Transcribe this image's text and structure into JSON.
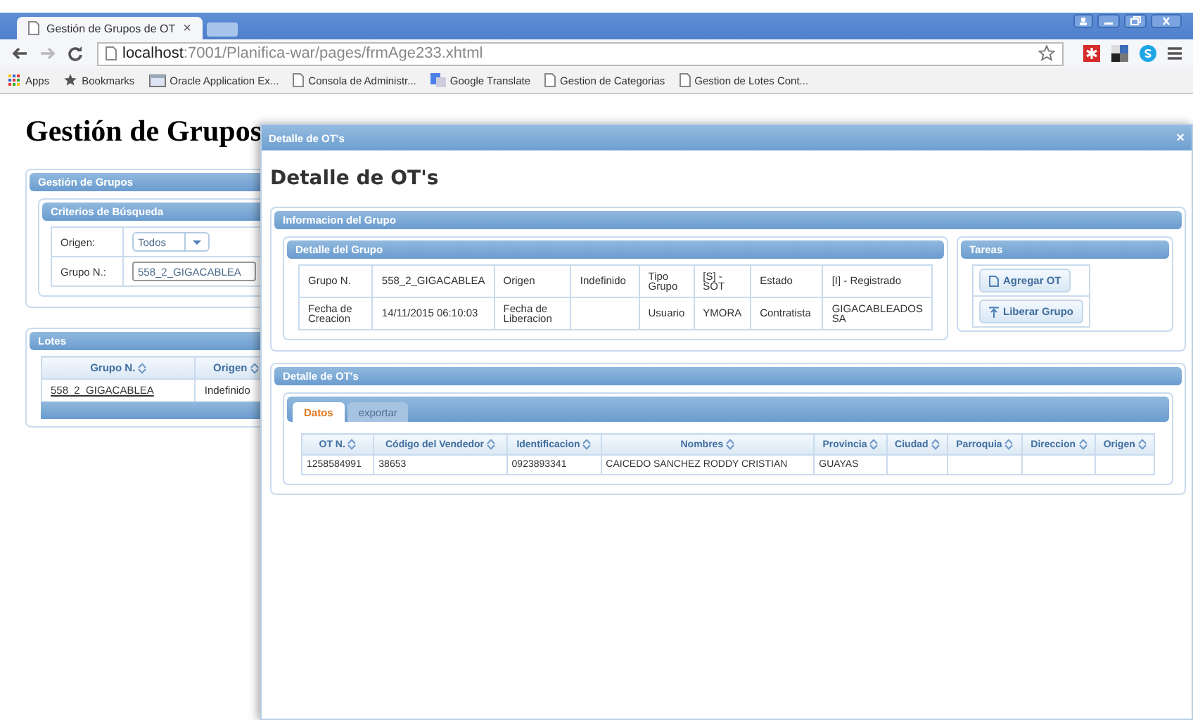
{
  "browser": {
    "tab_title": "Gestión de Grupos de OT",
    "tab_close": "×",
    "url_host": "localhost",
    "url_path": ":7001/Planifica-war/pages/frmAge233.xhtml",
    "bookmarks": [
      {
        "label": "Apps",
        "kind": "apps"
      },
      {
        "label": "Bookmarks",
        "kind": "star"
      },
      {
        "label": "Oracle Application Ex...",
        "kind": "folder"
      },
      {
        "label": "Consola de Administr...",
        "kind": "page"
      },
      {
        "label": "Google Translate",
        "kind": "translate"
      },
      {
        "label": "Gestion de Categorias",
        "kind": "page"
      },
      {
        "label": "Gestion de Lotes Cont...",
        "kind": "page"
      }
    ]
  },
  "page": {
    "heading": "Gestión de Grupos",
    "gestion_panel": {
      "title": "Gestión de Grupos",
      "criteria": {
        "title": "Criterios de Búsqueda",
        "fields": [
          {
            "label": "Origen:",
            "kind": "select",
            "value": "Todos"
          },
          {
            "label": "Grupo N.:",
            "kind": "input",
            "value": "558_2_GIGACABLEA"
          }
        ]
      }
    },
    "lotes": {
      "title": "Lotes",
      "columns": [
        "Grupo N.",
        "Origen"
      ],
      "rows": [
        [
          "558_2_GIGACABLEA",
          "Indefinido"
        ]
      ]
    }
  },
  "dialog": {
    "title": "Detalle de OT's",
    "close": "×",
    "heading": "Detalle de OT's",
    "info_panel": {
      "title": "Informacion del Grupo",
      "detail": {
        "title": "Detalle del Grupo",
        "rows": [
          [
            "Grupo N.",
            "558_2_GIGACABLEA",
            "Origen",
            "Indefinido",
            "Tipo Grupo",
            "[S] - SOT",
            "Estado",
            "[I] - Registrado"
          ],
          [
            "Fecha de Creacion",
            "14/11/2015 06:10:03",
            "Fecha de Liberacion",
            "",
            "Usuario",
            "YMORA",
            "Contratista",
            "GIGACABLEADOS SA"
          ]
        ]
      },
      "tareas": {
        "title": "Tareas",
        "buttons": [
          {
            "label": "Agregar OT",
            "kind": "add"
          },
          {
            "label": "Liberar Grupo",
            "kind": "release"
          }
        ]
      }
    },
    "ots_panel": {
      "title": "Detalle de OT's",
      "tabs": [
        {
          "label": "Datos",
          "selected": true
        },
        {
          "label": "exportar",
          "selected": false
        }
      ],
      "columns": [
        "OT N.",
        "Código del Vendedor",
        "Identificacion",
        "Nombres",
        "Provincia",
        "Ciudad",
        "Parroquia",
        "Direccion",
        "Origen"
      ],
      "rows": [
        [
          "1258584991",
          "38653",
          "0923893341",
          "CAICEDO SANCHEZ RODDY CRISTIAN",
          "GUAYAS",
          "",
          "",
          "",
          ""
        ]
      ]
    }
  }
}
